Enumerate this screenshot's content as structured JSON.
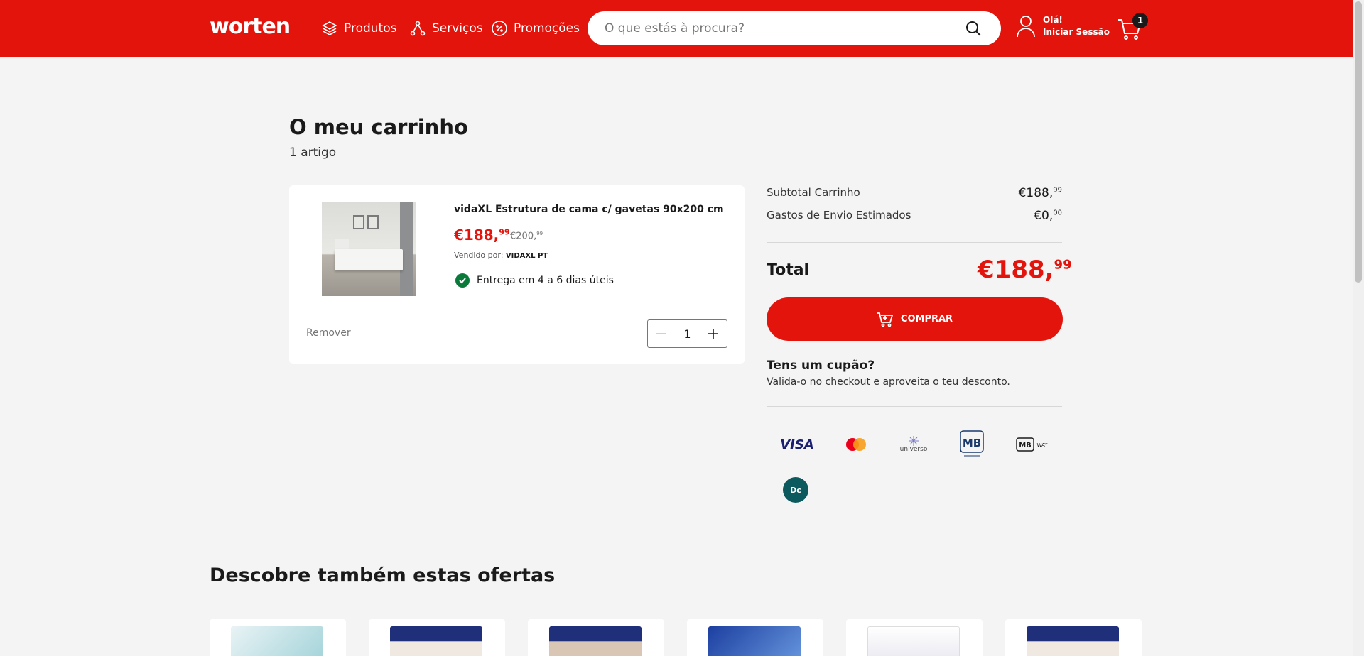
{
  "header": {
    "logo": "worten",
    "nav": [
      {
        "label": "Produtos",
        "icon": "layers-icon"
      },
      {
        "label": "Serviços",
        "icon": "services-icon"
      },
      {
        "label": "Promoções",
        "icon": "percent-icon"
      }
    ],
    "search_placeholder": "O que estás à procura?",
    "user_greeting": "Olá!",
    "user_login": "Iniciar Sessão",
    "cart_count": "1",
    "brand_color": "#e3140c"
  },
  "page": {
    "title": "O meu carrinho",
    "item_count": "1 artigo"
  },
  "cart_item": {
    "title": "vidaXL Estrutura de cama c/ gavetas 90x200 cm...",
    "price_int": "€188,",
    "price_dec": "99",
    "old_price_int": "€200,",
    "old_price_dec": "99",
    "seller_label": "Vendido por:",
    "seller_name": "VIDAXL PT",
    "delivery": "Entrega em 4 a 6 dias úteis",
    "remove": "Remover",
    "quantity": "1"
  },
  "summary": {
    "subtotal_label": "Subtotal Carrinho",
    "subtotal_int": "€188,",
    "subtotal_dec": "99",
    "shipping_label": "Gastos de Envio Estimados",
    "shipping_int": "€0,",
    "shipping_dec": "00",
    "total_label": "Total",
    "total_int": "€188,",
    "total_dec": "99",
    "buy_label": "COMPRAR",
    "coupon_title": "Tens um cupão?",
    "coupon_sub": "Valida-o no checkout e aproveita o teu desconto.",
    "payment_methods": [
      "VISA",
      "mastercard",
      "universo",
      "MB",
      "MB WAY",
      "Dc"
    ]
  },
  "offers": {
    "title": "Descobre também estas ofertas"
  }
}
